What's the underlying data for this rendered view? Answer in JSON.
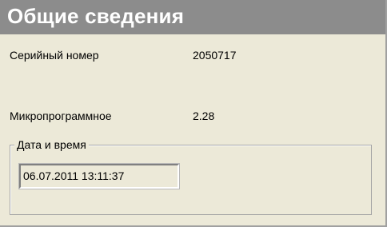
{
  "title": "Общие сведения",
  "fields": [
    {
      "label": "Серийный номер",
      "value": "2050717"
    },
    {
      "label": "Микропрограммное",
      "value": "2.28"
    }
  ],
  "datetime_group": {
    "legend": "Дата и время",
    "value": "06.07.2011 13:11:37"
  }
}
